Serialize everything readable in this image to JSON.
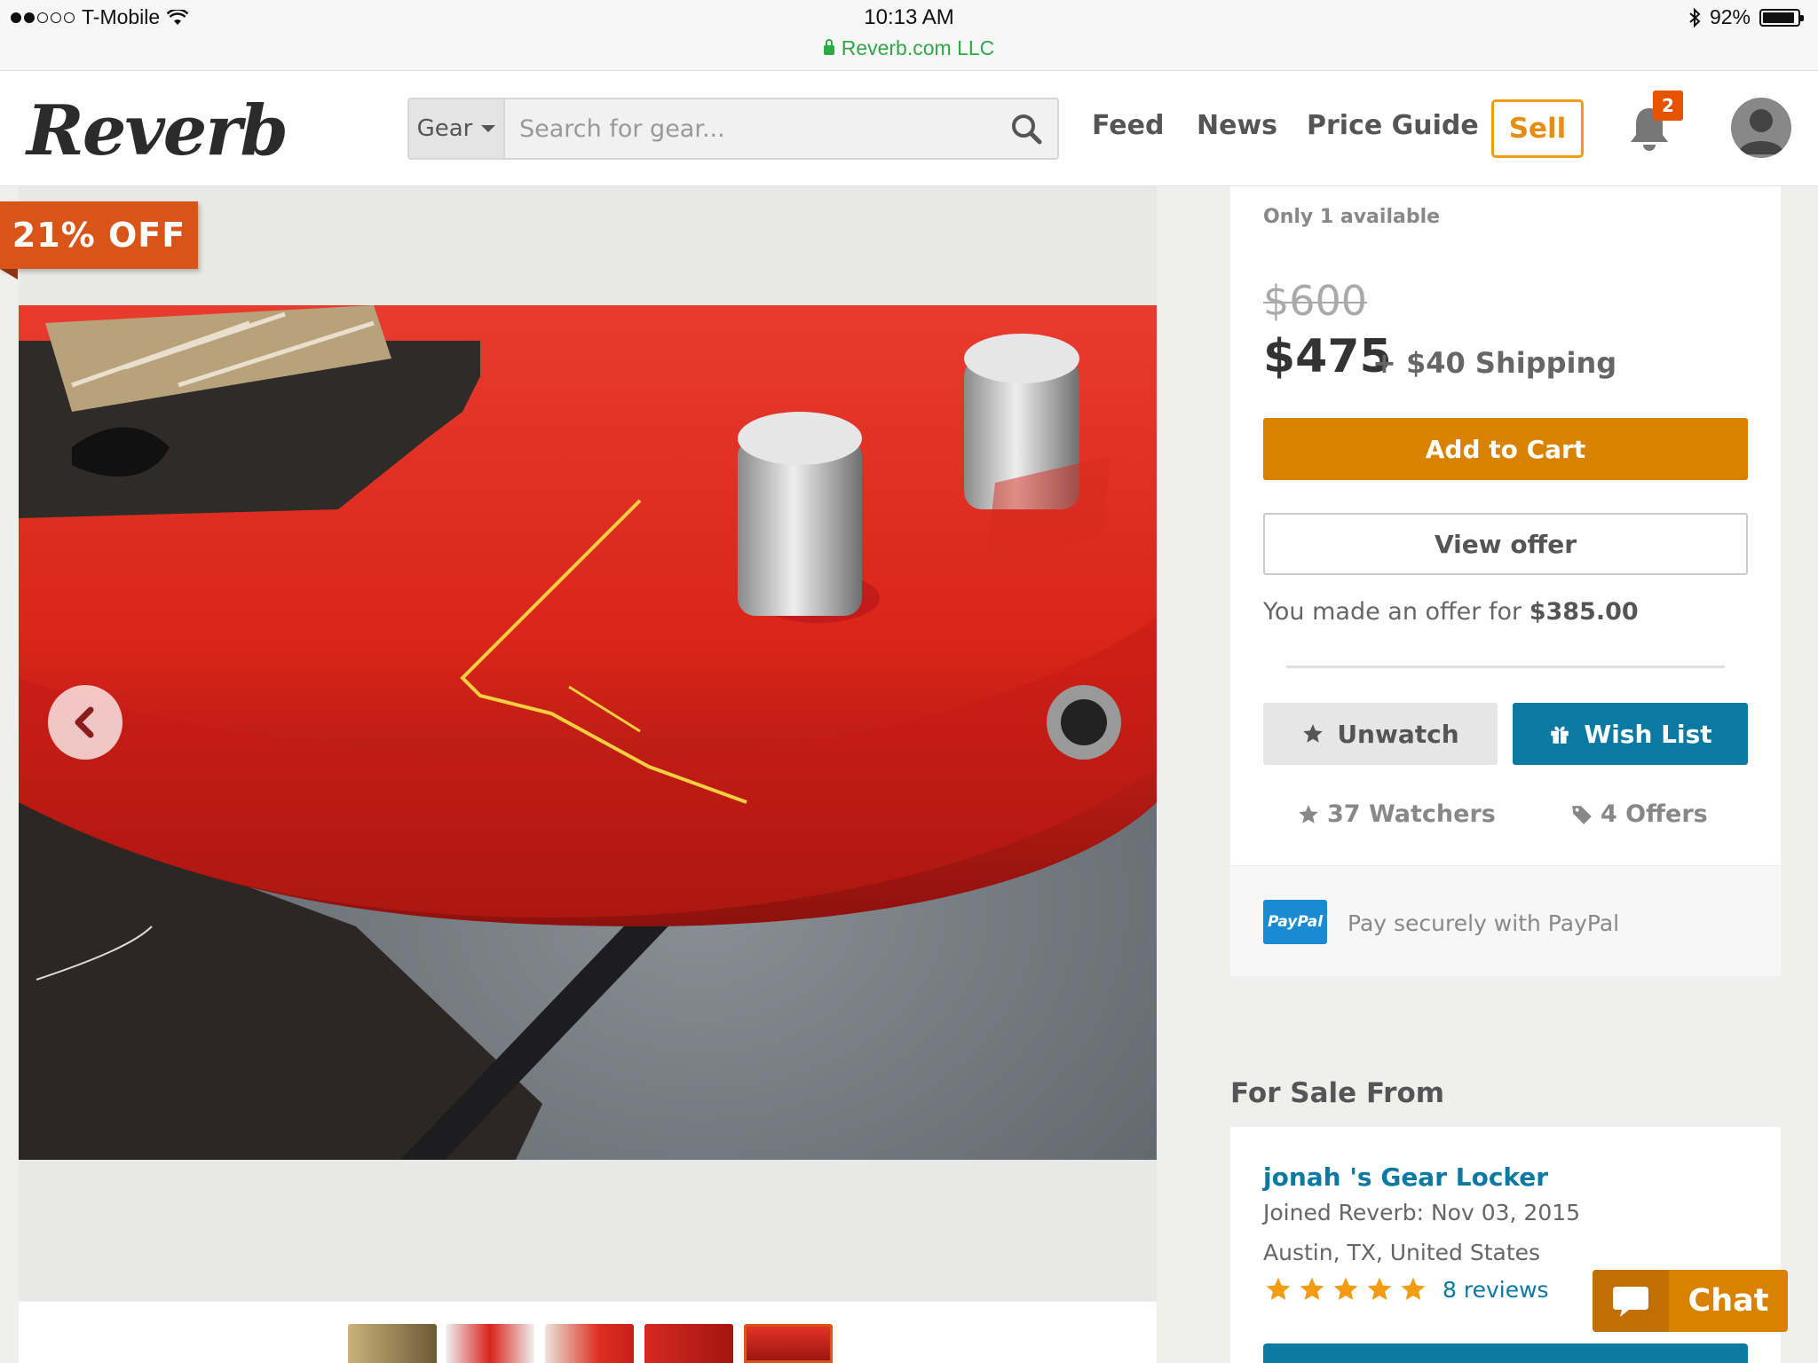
{
  "status_bar": {
    "carrier": "T-Mobile",
    "time": "10:13 AM",
    "url": "Reverb.com LLC",
    "battery": "92%"
  },
  "header": {
    "logo": "Reverb",
    "search_category": "Gear",
    "search_placeholder": "Search for gear...",
    "nav": [
      "Feed",
      "News",
      "Price Guide"
    ],
    "sell_label": "Sell",
    "notification_count": "2"
  },
  "listing": {
    "discount_label": "21% OFF",
    "availability": "Only 1 available",
    "original_price": "$600",
    "price": "$475",
    "shipping": "+ $40 Shipping",
    "add_to_cart": "Add to Cart",
    "view_offer": "View offer",
    "offer_prefix": "You made an offer for",
    "offer_amount": "$385.00",
    "unwatch_label": "Unwatch",
    "wishlist_label": "Wish List",
    "watchers": "37 Watchers",
    "offers": "4 Offers",
    "paypal_logo": "PayPal",
    "paypal_text": "Pay securely with PayPal"
  },
  "seller": {
    "section_title": "For Sale From",
    "name": "jonah 's Gear Locker",
    "joined": "Joined Reverb: Nov 03, 2015",
    "location": "Austin, TX, United States",
    "rating": 5,
    "reviews": "8 reviews"
  },
  "chat": {
    "label": "Chat"
  },
  "colors": {
    "brand_orange": "#d98200",
    "brand_blue": "#0b7aa3",
    "discount_red": "#d95418",
    "url_green": "#2fa847"
  }
}
